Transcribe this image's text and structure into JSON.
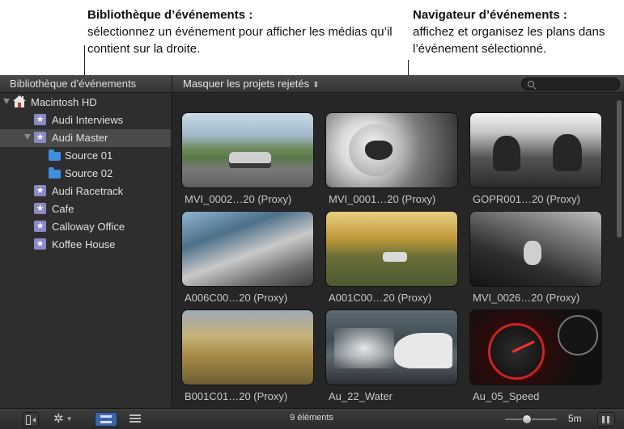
{
  "callouts": {
    "left": {
      "title": "Bibliothèque d’événements :",
      "description": "sélectionnez un événement pour afficher les médias qu’il contient sur la droite."
    },
    "right": {
      "title": "Navigateur d’événements :",
      "description": "affichez et organisez les plans dans l’événement sélectionné."
    }
  },
  "titlebar": {
    "library_title": "Bibliothèque d’événements",
    "filter_label": "Masquer les projets rejetés",
    "filter_arrows": "⬍",
    "search_placeholder": ""
  },
  "sidebar": {
    "items": [
      {
        "label": "Macintosh HD",
        "icon": "house-icon",
        "expanded": true
      },
      {
        "label": "Audi Interviews",
        "icon": "event-star-icon"
      },
      {
        "label": "Audi Master",
        "icon": "event-star-icon",
        "expanded": true,
        "selected": true
      },
      {
        "label": "Source 01",
        "icon": "folder-icon"
      },
      {
        "label": "Source 02",
        "icon": "folder-icon"
      },
      {
        "label": "Audi Racetrack",
        "icon": "event-star-icon"
      },
      {
        "label": "Cafe",
        "icon": "event-star-icon"
      },
      {
        "label": "Calloway Office",
        "icon": "event-star-icon"
      },
      {
        "label": "Koffee House",
        "icon": "event-star-icon"
      }
    ],
    "star_glyph": "★"
  },
  "browser": {
    "clips": [
      {
        "name": "MVI_0002…20 (Proxy)"
      },
      {
        "name": "MVI_0001…20 (Proxy)"
      },
      {
        "name": "GOPR001…20 (Proxy)"
      },
      {
        "name": "A006C00…20 (Proxy)"
      },
      {
        "name": "A001C00…20 (Proxy)"
      },
      {
        "name": "MVI_0026…20 (Proxy)"
      },
      {
        "name": "B001C01…20 (Proxy)"
      },
      {
        "name": "Au_22_Water"
      },
      {
        "name": "Au_05_Speed"
      }
    ]
  },
  "bottombar": {
    "gear_glyph": "✲",
    "gear_caret": "▼",
    "item_count": "9 éléments",
    "zoom_level": 0.4,
    "duration": "5m"
  }
}
